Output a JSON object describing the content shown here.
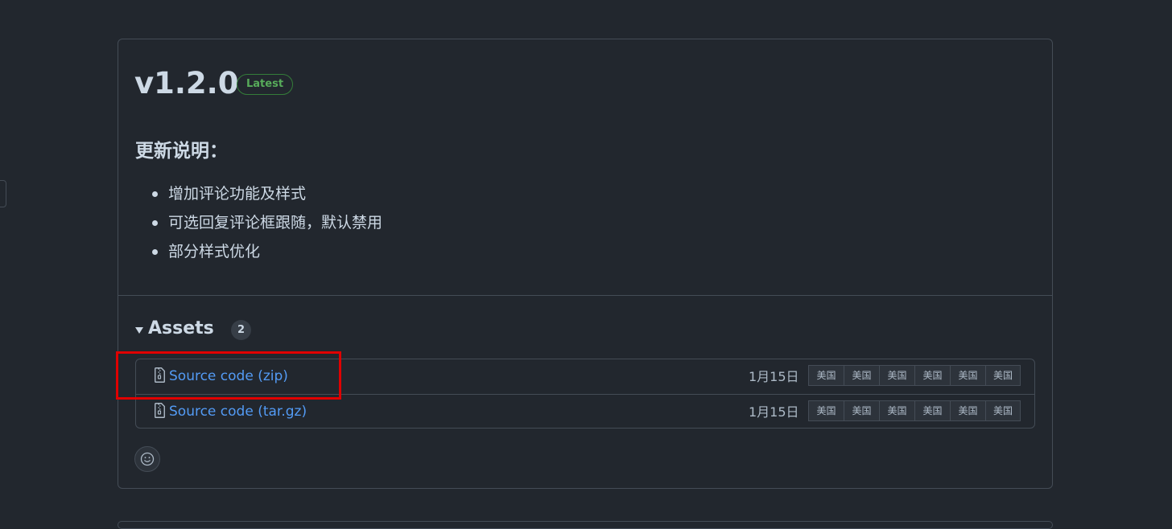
{
  "release": {
    "version": "v1.2.0",
    "badge": "Latest",
    "notes_heading": "更新说明：",
    "notes": [
      "增加评论功能及样式",
      "可选回复评论框跟随，默认禁用",
      "部分样式优化"
    ]
  },
  "assets": {
    "title": "Assets",
    "count": "2",
    "items": [
      {
        "name": "Source code",
        "ext": "(zip)",
        "date": "1月15日",
        "tags": [
          "美国",
          "美国",
          "美国",
          "美国",
          "美国",
          "美国"
        ],
        "icon": "file-zip-icon"
      },
      {
        "name": "Source code",
        "ext": "(tar.gz)",
        "date": "1月15日",
        "tags": [
          "美国",
          "美国",
          "美国",
          "美国",
          "美国",
          "美国"
        ],
        "icon": "file-zip-icon"
      }
    ]
  },
  "reaction": {
    "icon": "smiley-icon"
  },
  "colors": {
    "background": "#22272e",
    "link": "#539bf5",
    "badge_green": "#57ab5a",
    "highlight_red": "#e00000"
  }
}
